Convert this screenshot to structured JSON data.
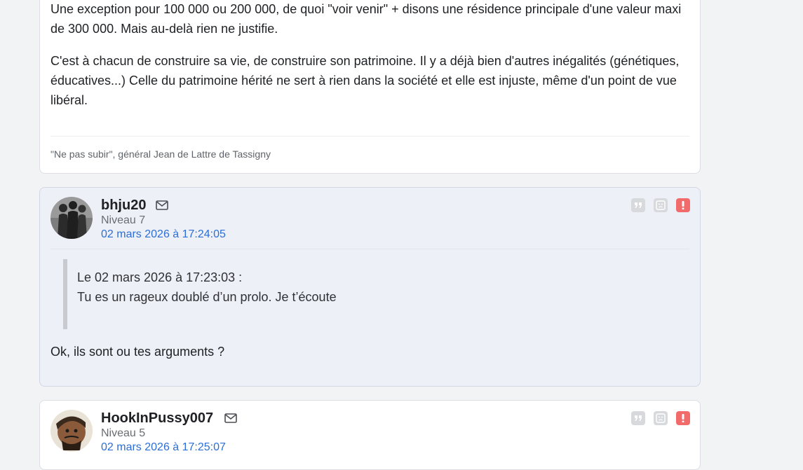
{
  "posts": [
    {
      "paragraphs": [
        "Une exception pour 100 000 ou 200 000, de quoi \"voir venir\" + disons une résidence principale d'une valeur maxi de 300 000. Mais au-delà rien ne justifie.",
        "C'est à chacun de construire sa vie, de construire son patrimoine. Il y a déjà bien d'autres inégalités (génétiques, éducatives...) Celle du patrimoine hérité ne sert à rien dans la société et elle est injuste, même d'un point de vue libéral."
      ],
      "signature": "\"Ne pas subir\", général Jean de Lattre de Tassigny"
    },
    {
      "author": "bhju20",
      "level": "Niveau 7",
      "date": "02 mars 2026 à 17:24:05",
      "quote": {
        "header": "Le 02 mars 2026 à 17:23:03 :",
        "text": "Tu es un rageux doublé d’un prolo. Je t’écoute"
      },
      "text": "Ok, ils sont ou tes arguments ?"
    },
    {
      "author": "HookInPussy007",
      "level": "Niveau 5",
      "date": "02 mars 2026 à 17:25:07"
    }
  ],
  "icons": {
    "mail": "mail-icon",
    "quote": "quote-icon",
    "sad": "sad-face-icon",
    "report": "report-icon"
  },
  "colors": {
    "link": "#2c6ed5",
    "report": "#f26b6b",
    "alt_background": "#eef0f7"
  }
}
